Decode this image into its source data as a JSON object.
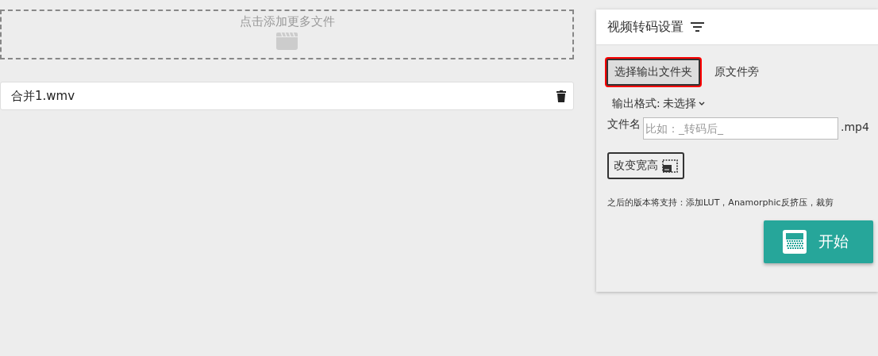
{
  "drop_zone": {
    "label": "点击添加更多文件"
  },
  "files": [
    {
      "name": "合并1.wmv"
    }
  ],
  "settings": {
    "title": "视频转码设置",
    "output_folder_button": {
      "label": "选择输出文件夹",
      "highlighted": true
    },
    "output_folder": "原文件旁",
    "output_format": {
      "label": "输出格式:",
      "value": "未选择"
    },
    "filename": {
      "label": "文件名",
      "placeholder": "比如：_转码后_",
      "extension": ".mp4"
    },
    "resize_button": {
      "label": "改变宽高"
    },
    "note": "之后的版本将支持：添加LUT，Anamorphic反挤压，裁剪",
    "start_button": {
      "label": "开始"
    }
  }
}
